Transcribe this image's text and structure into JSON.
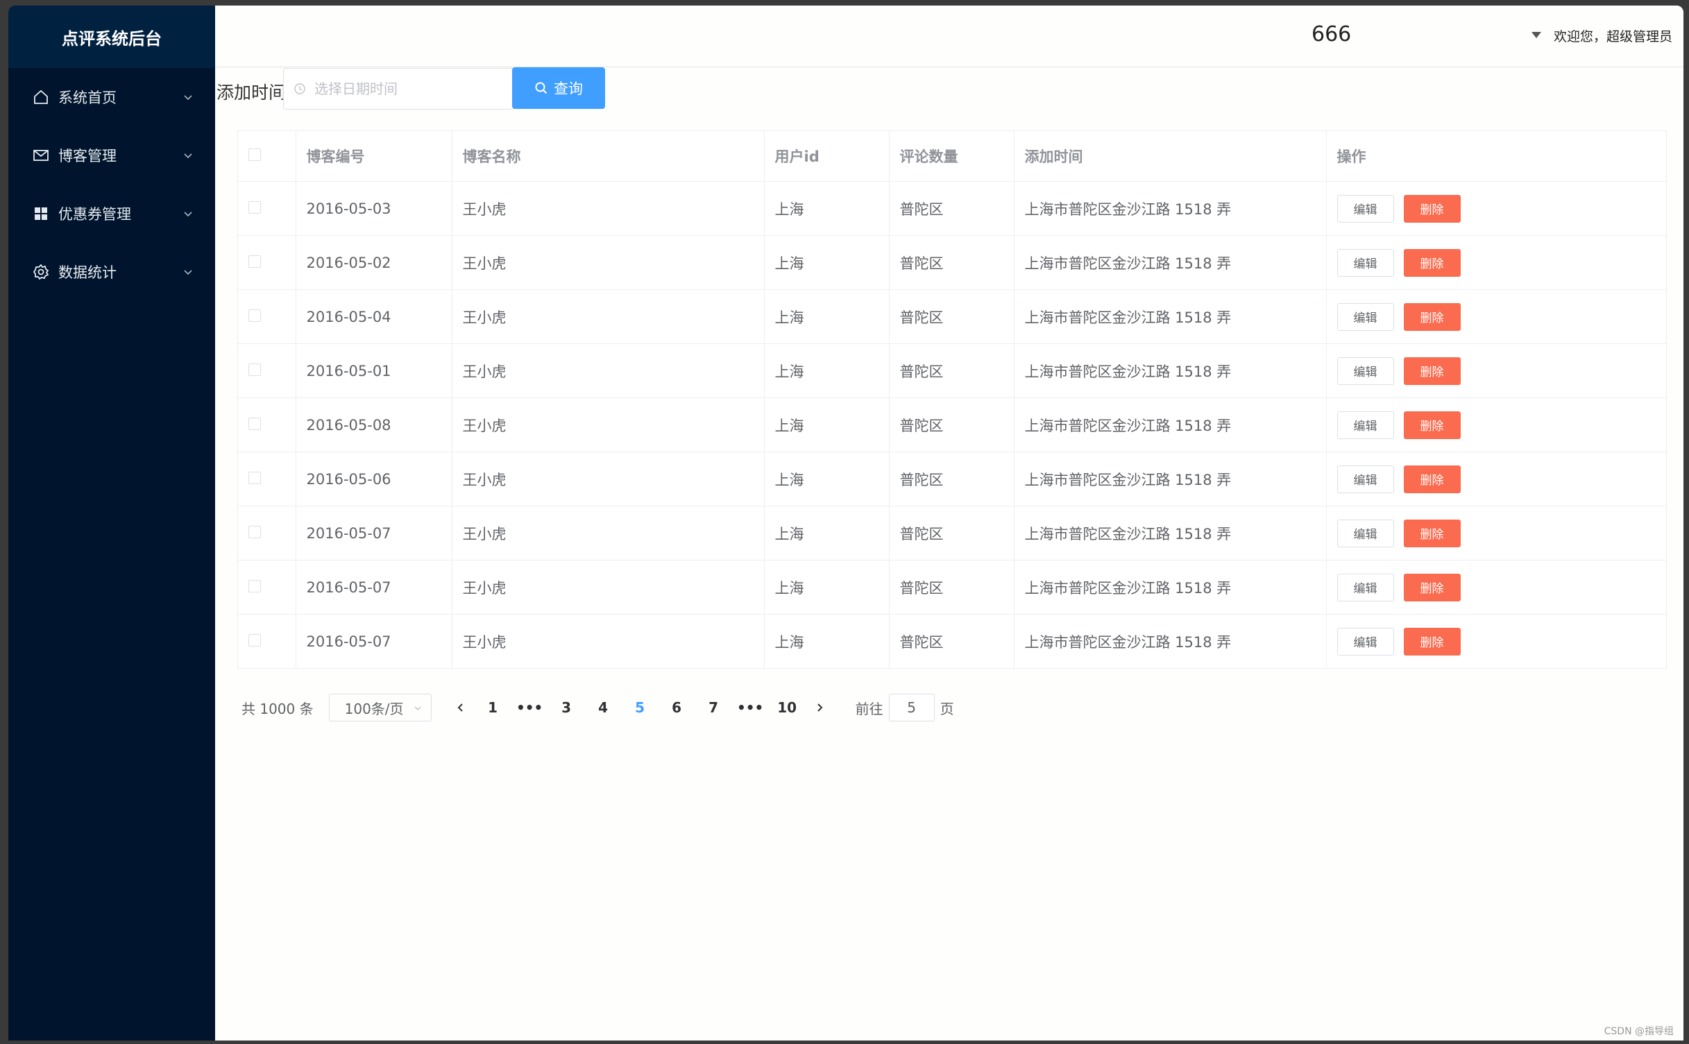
{
  "sidebar": {
    "title": "点评系统后台",
    "items": [
      {
        "label": "系统首页",
        "icon": "home-icon"
      },
      {
        "label": "博客管理",
        "icon": "mail-icon"
      },
      {
        "label": "优惠券管理",
        "icon": "grid-icon"
      },
      {
        "label": "数据统计",
        "icon": "gear-icon"
      }
    ]
  },
  "header": {
    "number": "666",
    "welcome": "欢迎您，超级管理员"
  },
  "filter": {
    "label": "添加时间",
    "placeholder": "选择日期时间",
    "query_label": "查询"
  },
  "table": {
    "columns": [
      "博客编号",
      "博客名称",
      "用户id",
      "评论数量",
      "添加时间",
      "操作"
    ],
    "edit_label": "编辑",
    "delete_label": "删除",
    "rows": [
      [
        "2016-05-03",
        "王小虎",
        "上海",
        "普陀区",
        "上海市普陀区金沙江路 1518 弄"
      ],
      [
        "2016-05-02",
        "王小虎",
        "上海",
        "普陀区",
        "上海市普陀区金沙江路 1518 弄"
      ],
      [
        "2016-05-04",
        "王小虎",
        "上海",
        "普陀区",
        "上海市普陀区金沙江路 1518 弄"
      ],
      [
        "2016-05-01",
        "王小虎",
        "上海",
        "普陀区",
        "上海市普陀区金沙江路 1518 弄"
      ],
      [
        "2016-05-08",
        "王小虎",
        "上海",
        "普陀区",
        "上海市普陀区金沙江路 1518 弄"
      ],
      [
        "2016-05-06",
        "王小虎",
        "上海",
        "普陀区",
        "上海市普陀区金沙江路 1518 弄"
      ],
      [
        "2016-05-07",
        "王小虎",
        "上海",
        "普陀区",
        "上海市普陀区金沙江路 1518 弄"
      ],
      [
        "2016-05-07",
        "王小虎",
        "上海",
        "普陀区",
        "上海市普陀区金沙江路 1518 弄"
      ],
      [
        "2016-05-07",
        "王小虎",
        "上海",
        "普陀区",
        "上海市普陀区金沙江路 1518 弄"
      ]
    ]
  },
  "pagination": {
    "total": "共 1000 条",
    "page_size": "100条/页",
    "pages": [
      "1",
      "•••",
      "3",
      "4",
      "5",
      "6",
      "7",
      "•••",
      "10"
    ],
    "current": "5",
    "goto_prefix": "前往",
    "goto_value": "5",
    "goto_suffix": "页"
  },
  "watermark": "CSDN @指导组",
  "colors": {
    "sidebar": "#00152d",
    "primary": "#409eff",
    "danger": "#fa6b4f"
  }
}
